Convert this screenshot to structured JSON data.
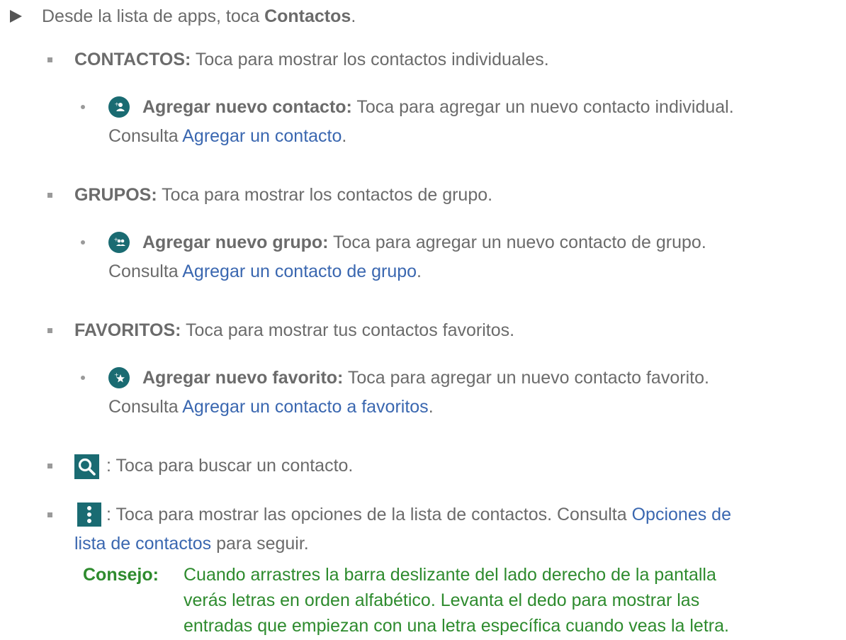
{
  "intro": {
    "prefix": "Desde la lista de apps, toca ",
    "app_name": "Contactos",
    "suffix": "."
  },
  "items": {
    "contactos": {
      "title": "CONTACTOS:",
      "desc": " Toca para mostrar los contactos individuales."
    },
    "add_contact": {
      "title": "Agregar nuevo contacto:",
      "desc": " Toca para agregar un nuevo contacto individual.",
      "see": "Consulta ",
      "link": "Agregar un contacto",
      "end": "."
    },
    "grupos": {
      "title": "GRUPOS:",
      "desc": " Toca para mostrar los contactos de grupo."
    },
    "add_group": {
      "title": "Agregar nuevo grupo:",
      "desc": " Toca para agregar un nuevo contacto de grupo.",
      "see": "Consulta ",
      "link": "Agregar un contacto de grupo",
      "end": "."
    },
    "favoritos": {
      "title": "FAVORITOS:",
      "desc": " Toca para mostrar tus contactos favoritos."
    },
    "add_favorite": {
      "title": "Agregar nuevo favorito:",
      "desc": " Toca para agregar un nuevo contacto favorito.",
      "see": "Consulta ",
      "link": "Agregar un contacto a favoritos",
      "end": "."
    },
    "search": {
      "desc": ": Toca para buscar un contacto."
    },
    "menu": {
      "desc": ": Toca para mostrar las opciones de la lista de contactos. Consulta ",
      "link_part1": "Opciones de",
      "link_part2": "lista de contactos",
      "end": " para seguir."
    }
  },
  "tip": {
    "label": "Consejo:",
    "line1": "Cuando arrastres la barra deslizante del lado derecho de la pantalla",
    "line2": "verás letras en orden alfabético. Levanta el dedo para mostrar las",
    "line3": "entradas que empiezan con una letra específica cuando veas la letra."
  },
  "icons": {
    "add_contact": "add-contact-icon",
    "add_group": "add-group-icon",
    "add_favorite": "add-favorite-icon",
    "search": "search-icon",
    "menu": "more-vert-icon"
  },
  "colors": {
    "text": "#6b6b6b",
    "link": "#3a67b0",
    "tip": "#2e8b2e",
    "icon_bg": "#1a6b72"
  }
}
